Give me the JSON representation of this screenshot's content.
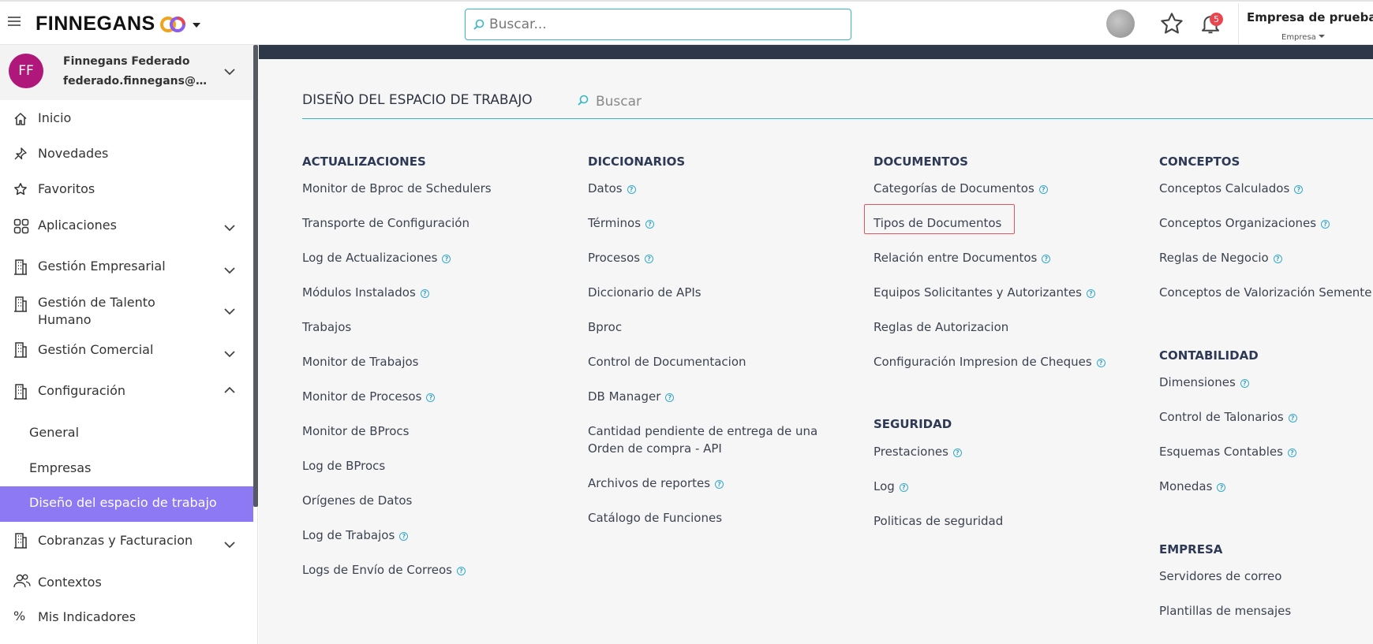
{
  "header": {
    "logo_text": "FINNEGANS",
    "search_placeholder": "Buscar...",
    "notifications_count": "5",
    "company_name": "Empresa de prueba",
    "company_label": "Empresa"
  },
  "colors": {
    "accent": "#36b6c9",
    "active_nav": "#8c79f3",
    "avatar": "#b0177a",
    "band": "#2e3848",
    "badge": "#e8474f",
    "highlight": "#e05561"
  },
  "sidebar": {
    "profile": {
      "initials": "FF",
      "name": "Finnegans Federado",
      "email": "federado.finnegans@finnegans.com"
    },
    "items": [
      {
        "label": "Inicio",
        "icon": "home-icon"
      },
      {
        "label": "Novedades",
        "icon": "pin-icon"
      },
      {
        "label": "Favoritos",
        "icon": "star-icon"
      },
      {
        "label": "Aplicaciones",
        "icon": "apps-grid-icon"
      },
      {
        "label": "Gestión Empresarial",
        "icon": "building-icon"
      },
      {
        "label": "Gestión de Talento Humano",
        "icon": "building-icon"
      },
      {
        "label": "Gestión Comercial",
        "icon": "building-icon"
      },
      {
        "label": "Configuración",
        "icon": "building-icon"
      },
      {
        "label": "Cobranzas y Facturacion",
        "icon": "building-icon"
      },
      {
        "label": "Contextos",
        "icon": "people-icon"
      },
      {
        "label": "Mis Indicadores",
        "icon": "percent-icon"
      }
    ],
    "config_sub": [
      "General",
      "Empresas",
      "Diseño del espacio de trabajo"
    ]
  },
  "main": {
    "title": "DISEÑO DEL ESPACIO DE TRABAJO",
    "search_placeholder": "Buscar",
    "sections": {
      "actualizaciones": {
        "title": "ACTUALIZACIONES",
        "items": [
          "Monitor de Bproc de Schedulers",
          "Transporte de Configuración",
          "Log de Actualizaciones",
          "Módulos Instalados",
          "Trabajos",
          "Monitor de Trabajos",
          "Monitor de Procesos",
          "Monitor de BProcs",
          "Log de BProcs",
          "Orígenes de Datos",
          "Log de Trabajos",
          "Logs de Envío de Correos"
        ]
      },
      "diccionarios": {
        "title": "DICCIONARIOS",
        "items": [
          "Datos",
          "Términos",
          "Procesos",
          "Diccionario de APIs",
          "Bproc",
          "Control de Documentacion",
          "DB Manager",
          "Cantidad pendiente de entrega de una Orden de compra - API",
          "Archivos de reportes",
          "Catálogo de Funciones"
        ]
      },
      "documentos": {
        "title": "DOCUMENTOS",
        "items": [
          "Categorías de Documentos",
          "Tipos de Documentos",
          "Relación entre Documentos",
          "Equipos Solicitantes y Autorizantes",
          "Reglas de Autorizacion",
          "Configuración Impresion de Cheques"
        ]
      },
      "seguridad": {
        "title": "SEGURIDAD",
        "items": [
          "Prestaciones",
          "Log",
          "Politicas de seguridad"
        ]
      },
      "conceptos": {
        "title": "CONCEPTOS",
        "items": [
          "Conceptos Calculados",
          "Conceptos Organizaciones",
          "Reglas de Negocio",
          "Conceptos de Valorización Sementera"
        ]
      },
      "contabilidad": {
        "title": "CONTABILIDAD",
        "items": [
          "Dimensiones",
          "Control de Talonarios",
          "Esquemas Contables",
          "Monedas"
        ]
      },
      "empresa": {
        "title": "EMPRESA",
        "items": [
          "Servidores de correo",
          "Plantillas de mensajes"
        ]
      }
    }
  }
}
